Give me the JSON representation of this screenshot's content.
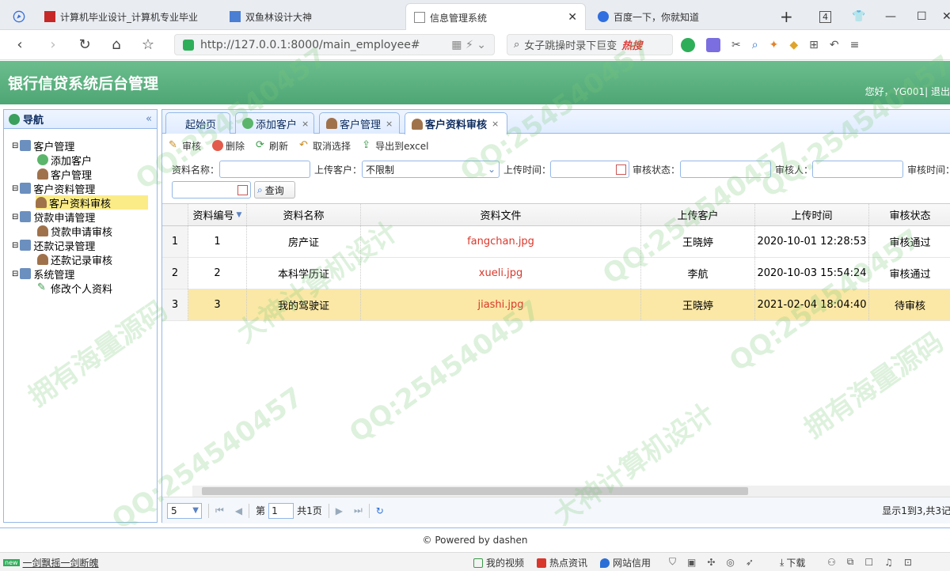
{
  "browser": {
    "tabs": [
      {
        "title": "计算机毕业设计_计算机专业毕业"
      },
      {
        "title": "双鱼林设计大神"
      },
      {
        "title": "信息管理系统"
      },
      {
        "title": "百度一下，你就知道"
      }
    ],
    "tab_count": "4",
    "address": "http://127.0.0.1:8000/main_employee#",
    "search_text": "女子跳操时录下巨变",
    "search_badge": "热搜"
  },
  "app": {
    "title": "银行信贷系统后台管理",
    "user_info": "您好，YG001| 退出"
  },
  "nav": {
    "title": "导航",
    "tree": [
      {
        "label": "客户管理"
      },
      {
        "label": "添加客户"
      },
      {
        "label": "客户管理"
      },
      {
        "label": "客户资料管理"
      },
      {
        "label": "客户资料审核"
      },
      {
        "label": "贷款申请管理"
      },
      {
        "label": "贷款申请审核"
      },
      {
        "label": "还款记录管理"
      },
      {
        "label": "还款记录审核"
      },
      {
        "label": "系统管理"
      },
      {
        "label": "修改个人资料"
      }
    ]
  },
  "tabs": [
    {
      "label": "起始页"
    },
    {
      "label": "添加客户"
    },
    {
      "label": "客户管理"
    },
    {
      "label": "客户资料审核"
    }
  ],
  "toolbar": {
    "audit": "审核",
    "delete": "删除",
    "refresh": "刷新",
    "cancel_select": "取消选择",
    "export": "导出到excel"
  },
  "filter": {
    "name_label": "资料名称：",
    "uploader_label": "上传客户：",
    "uploader_value": "不限制",
    "upload_time_label": "上传时间：",
    "status_label": "审核状态：",
    "auditor_label": "审核人：",
    "audit_time_label": "审核时间：",
    "query": "查询"
  },
  "grid": {
    "columns": [
      "资料编号",
      "资料名称",
      "资料文件",
      "上传客户",
      "上传时间",
      "审核状态"
    ],
    "rows": [
      {
        "rownum": "1",
        "id": "1",
        "name": "房产证",
        "file": "fangchan.jpg",
        "customer": "王晓婷",
        "time": "2020-10-01 12:28:53",
        "status": "审核通过"
      },
      {
        "rownum": "2",
        "id": "2",
        "name": "本科学历证",
        "file": "xueli.jpg",
        "customer": "李航",
        "time": "2020-10-03 15:54:24",
        "status": "审核通过"
      },
      {
        "rownum": "3",
        "id": "3",
        "name": "我的驾驶证",
        "file": "jiashi.jpg",
        "customer": "王晓婷",
        "time": "2021-02-04 18:04:40",
        "status": "待审核"
      }
    ]
  },
  "pager": {
    "page_size": "5",
    "page_prefix": "第",
    "page_value": "1",
    "page_suffix": "共1页",
    "summary": "显示1到3,共3记"
  },
  "footer": "© Powered by dashen",
  "statusbar": {
    "left": "一剑飘摇一剑断魄",
    "items": [
      "我的视频",
      "热点资讯",
      "网站信用",
      "下载"
    ]
  },
  "watermarks": [
    "QQ:254540457",
    "大神计算机设计",
    "拥有海量源码"
  ],
  "colors": {
    "header_green": "#4ea674",
    "selected_row": "#fbe8a6",
    "panel_border": "#95b8e7",
    "file_link": "#d9372b"
  }
}
